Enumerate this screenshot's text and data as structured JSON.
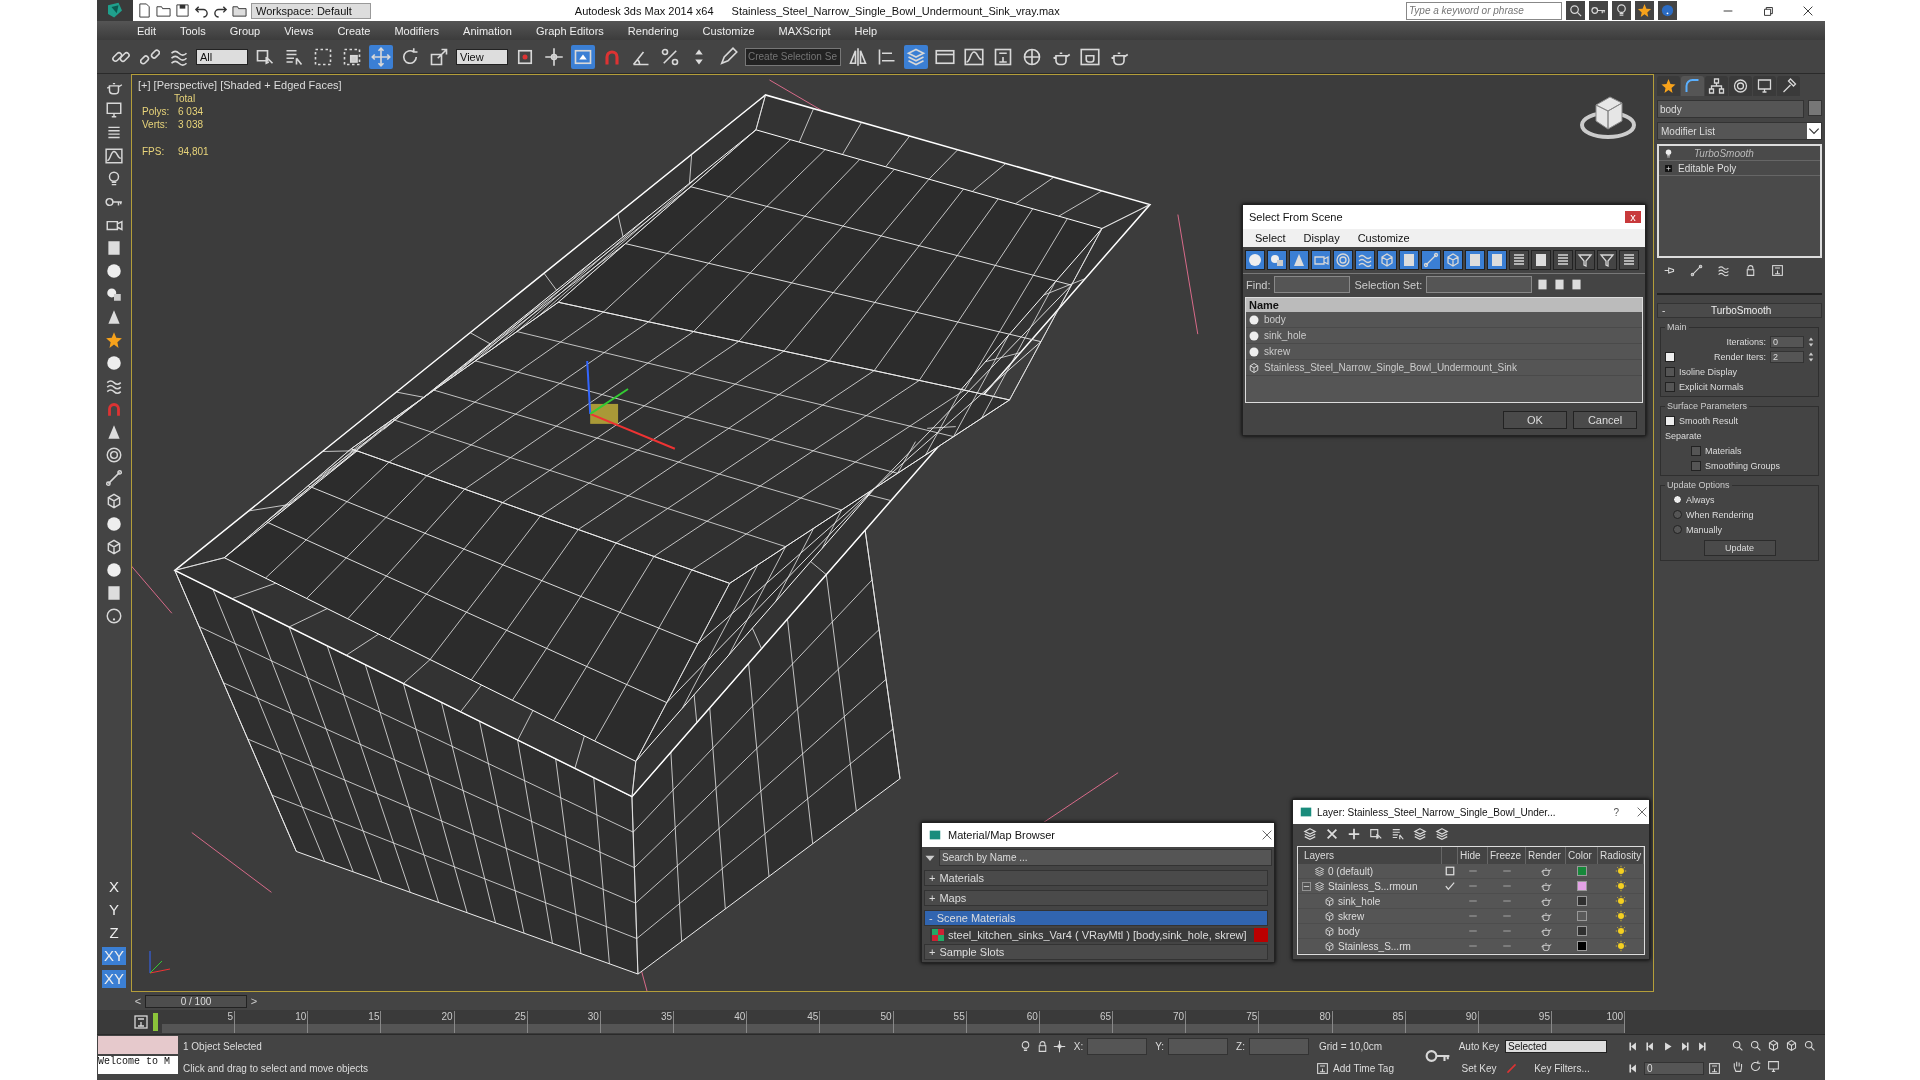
{
  "title_bar": {
    "workspace": "Workspace: Default",
    "app": "Autodesk 3ds Max  2014 x64",
    "file": "Stainless_Steel_Narrow_Single_Bowl_Undermount_Sink_vray.max",
    "search": {
      "placeholder": "Type a keyword or phrase"
    }
  },
  "menu": [
    "Edit",
    "Tools",
    "Group",
    "Views",
    "Create",
    "Modifiers",
    "Animation",
    "Graph Editors",
    "Rendering",
    "Customize",
    "MAXScript",
    "Help"
  ],
  "toolbar": [
    {
      "kind": "link",
      "selected": false
    },
    {
      "kind": "unlink",
      "selected": false
    },
    {
      "kind": "bind",
      "selected": false
    },
    {
      "kind": "dropdown",
      "value": "All"
    },
    {
      "kind": "select",
      "selected": false
    },
    {
      "kind": "select-name",
      "selected": false
    },
    {
      "kind": "region",
      "selected": false
    },
    {
      "kind": "window",
      "selected": false
    },
    {
      "kind": "move",
      "selected": true
    },
    {
      "kind": "rotate",
      "selected": false
    },
    {
      "kind": "scale",
      "selected": false
    },
    {
      "kind": "dropdown",
      "value": "View"
    },
    {
      "kind": "pivot",
      "selected": false
    },
    {
      "kind": "manipulate",
      "selected": false
    },
    {
      "kind": "shortcut",
      "selected": true
    },
    {
      "kind": "snap",
      "selected": false
    },
    {
      "kind": "angle-snap",
      "selected": false
    },
    {
      "kind": "percent-snap",
      "selected": false
    },
    {
      "kind": "spinner-snap",
      "selected": false
    },
    {
      "kind": "edit-named",
      "selected": false
    },
    {
      "kind": "field",
      "placeholder": "Create Selection Se"
    },
    {
      "kind": "mirror",
      "selected": false
    },
    {
      "kind": "align",
      "selected": false
    },
    {
      "kind": "layers",
      "selected": true
    },
    {
      "kind": "ribbon",
      "selected": false
    },
    {
      "kind": "curve",
      "selected": false
    },
    {
      "kind": "schematic",
      "selected": false
    },
    {
      "kind": "material",
      "selected": false
    },
    {
      "kind": "render-setup",
      "selected": false
    },
    {
      "kind": "frame",
      "selected": false
    },
    {
      "kind": "render",
      "selected": false
    }
  ],
  "viewport": {
    "label": "[+] [Perspective] [Shaded + Edged Faces]",
    "stats_heading": "Total",
    "stats": [
      {
        "label": "Polys:",
        "value": "6 034"
      },
      {
        "label": "Verts:",
        "value": "3 038"
      }
    ],
    "fps": {
      "label": "FPS:",
      "value": "94,801"
    }
  },
  "axes": [
    {
      "label": "X",
      "selected": false
    },
    {
      "label": "Y",
      "selected": false
    },
    {
      "label": "Z",
      "selected": false
    },
    {
      "label": "XY",
      "selected": true
    },
    {
      "label": "XY",
      "selected": true
    }
  ],
  "command_panel": {
    "tabs": [
      {
        "kind": "create",
        "selected": false
      },
      {
        "kind": "modify",
        "selected": true
      },
      {
        "kind": "hierarchy",
        "selected": false
      },
      {
        "kind": "motion",
        "selected": false
      },
      {
        "kind": "display",
        "selected": false
      },
      {
        "kind": "utilities",
        "selected": false
      }
    ],
    "object_name": "body",
    "modifier_list": "Modifier List",
    "stack": [
      {
        "name": "TurboSmooth",
        "kind": "modifier"
      },
      {
        "name": "Editable Poly",
        "kind": "base"
      }
    ],
    "rollout": {
      "toggle": "-",
      "title": "TurboSmooth",
      "groups": [
        {
          "title": "Main",
          "rows": [
            {
              "kind": "spinner",
              "label": "Iterations:",
              "value": "0"
            },
            {
              "kind": "check-spinner",
              "label": "Render Iters:",
              "value": "2",
              "checked": true
            },
            {
              "kind": "checkbox",
              "label": "Isoline Display",
              "checked": false
            },
            {
              "kind": "checkbox",
              "label": "Explicit Normals",
              "checked": false
            }
          ]
        },
        {
          "title": "Surface Parameters",
          "rows": [
            {
              "kind": "checkbox",
              "label": "Smooth Result",
              "checked": true
            },
            {
              "kind": "label",
              "label": "Separate"
            },
            {
              "kind": "sub-checkbox",
              "label": "Materials",
              "checked": false
            },
            {
              "kind": "sub-checkbox",
              "label": "Smoothing Groups",
              "checked": false
            }
          ]
        },
        {
          "title": "Update Options",
          "rows": [
            {
              "kind": "radio",
              "label": "Always",
              "selected": true
            },
            {
              "kind": "radio",
              "label": "When Rendering",
              "selected": false
            },
            {
              "kind": "radio",
              "label": "Manually",
              "selected": false
            },
            {
              "kind": "button",
              "label": "Update"
            }
          ]
        }
      ]
    }
  },
  "select_dialog": {
    "title": "Select From Scene",
    "close": "x",
    "menu": [
      "Select",
      "Display",
      "Customize"
    ],
    "filters": [
      {
        "kind": "geometry",
        "selected": true
      },
      {
        "kind": "shape",
        "selected": true
      },
      {
        "kind": "light",
        "selected": true
      },
      {
        "kind": "camera",
        "selected": true
      },
      {
        "kind": "helper",
        "selected": true
      },
      {
        "kind": "warp",
        "selected": true
      },
      {
        "kind": "group",
        "selected": true
      },
      {
        "kind": "xref",
        "selected": true
      },
      {
        "kind": "bone",
        "selected": true
      },
      {
        "kind": "container",
        "selected": true
      },
      {
        "kind": "frozen",
        "selected": true
      },
      {
        "kind": "hidden",
        "selected": true
      },
      {
        "kind": "all",
        "selected": false
      },
      {
        "kind": "none",
        "selected": false
      },
      {
        "kind": "invert",
        "selected": false
      },
      {
        "kind": "filter",
        "selected": false
      },
      {
        "kind": "filter-list",
        "selected": false
      },
      {
        "kind": "columns",
        "selected": false
      }
    ],
    "find_label": "Find:",
    "set_label": "Selection Set:",
    "column": "Name",
    "rows": [
      {
        "name": "body",
        "kind": "geometry"
      },
      {
        "name": "sink_hole",
        "kind": "geometry"
      },
      {
        "name": "skrew",
        "kind": "geometry"
      },
      {
        "name": "Stainless_Steel_Narrow_Single_Bowl_Undermount_Sink",
        "kind": "group"
      }
    ],
    "buttons": [
      "OK",
      "Cancel"
    ]
  },
  "material_browser": {
    "title": "Material/Map Browser",
    "search": {
      "placeholder": "Search by Name ..."
    },
    "sections": [
      {
        "sign": "+",
        "label": "Materials",
        "expanded": false
      },
      {
        "sign": "+",
        "label": "Maps",
        "expanded": false
      },
      {
        "sign": "-",
        "label": "Scene Materials",
        "expanded": true,
        "items": [
          "steel_kitchen_sinks_Var4  ( VRayMtl ) [body,sink_hole, skrew]"
        ]
      },
      {
        "sign": "+",
        "label": "Sample Slots",
        "expanded": false
      }
    ]
  },
  "layer_dialog": {
    "title": "Layer: Stainless_Steel_Narrow_Single_Bowl_Under...",
    "help": "?",
    "columns": [
      "Layers",
      "Hide",
      "Freeze",
      "Render",
      "Color",
      "Radiosity"
    ],
    "layers": [
      {
        "name": "0 (default)",
        "current": false,
        "color": "#16883a"
      },
      {
        "name": "Stainless_S...rmoun",
        "current": true,
        "expanded": true,
        "color": "#e3a2e6",
        "children": [
          {
            "name": "sink_hole",
            "color": "#303030"
          },
          {
            "name": "skrew",
            "color": "#5a5a5a"
          },
          {
            "name": "body",
            "color": "#303030"
          },
          {
            "name": "Stainless_S...rm",
            "color": "#000000"
          }
        ]
      }
    ]
  },
  "time_slider": {
    "prev": "<",
    "label": "0 / 100",
    "next": ">"
  },
  "ruler": [
    "5",
    "10",
    "15",
    "20",
    "25",
    "30",
    "35",
    "40",
    "45",
    "50",
    "55",
    "60",
    "65",
    "70",
    "75",
    "80",
    "85",
    "90",
    "95",
    "100"
  ],
  "status": {
    "listener": "Welcome to M",
    "selection": "1 Object Selected",
    "prompt": "Click and drag to select and move objects",
    "x_label": "X:",
    "y_label": "Y:",
    "z_label": "Z:",
    "grid": "Grid = 10,0cm",
    "time_tag": "Add Time Tag",
    "auto_key": "Auto Key",
    "set_key": "Set Key",
    "key_mode": "Selected",
    "key_filters": "Key Filters...",
    "frame": "0"
  }
}
